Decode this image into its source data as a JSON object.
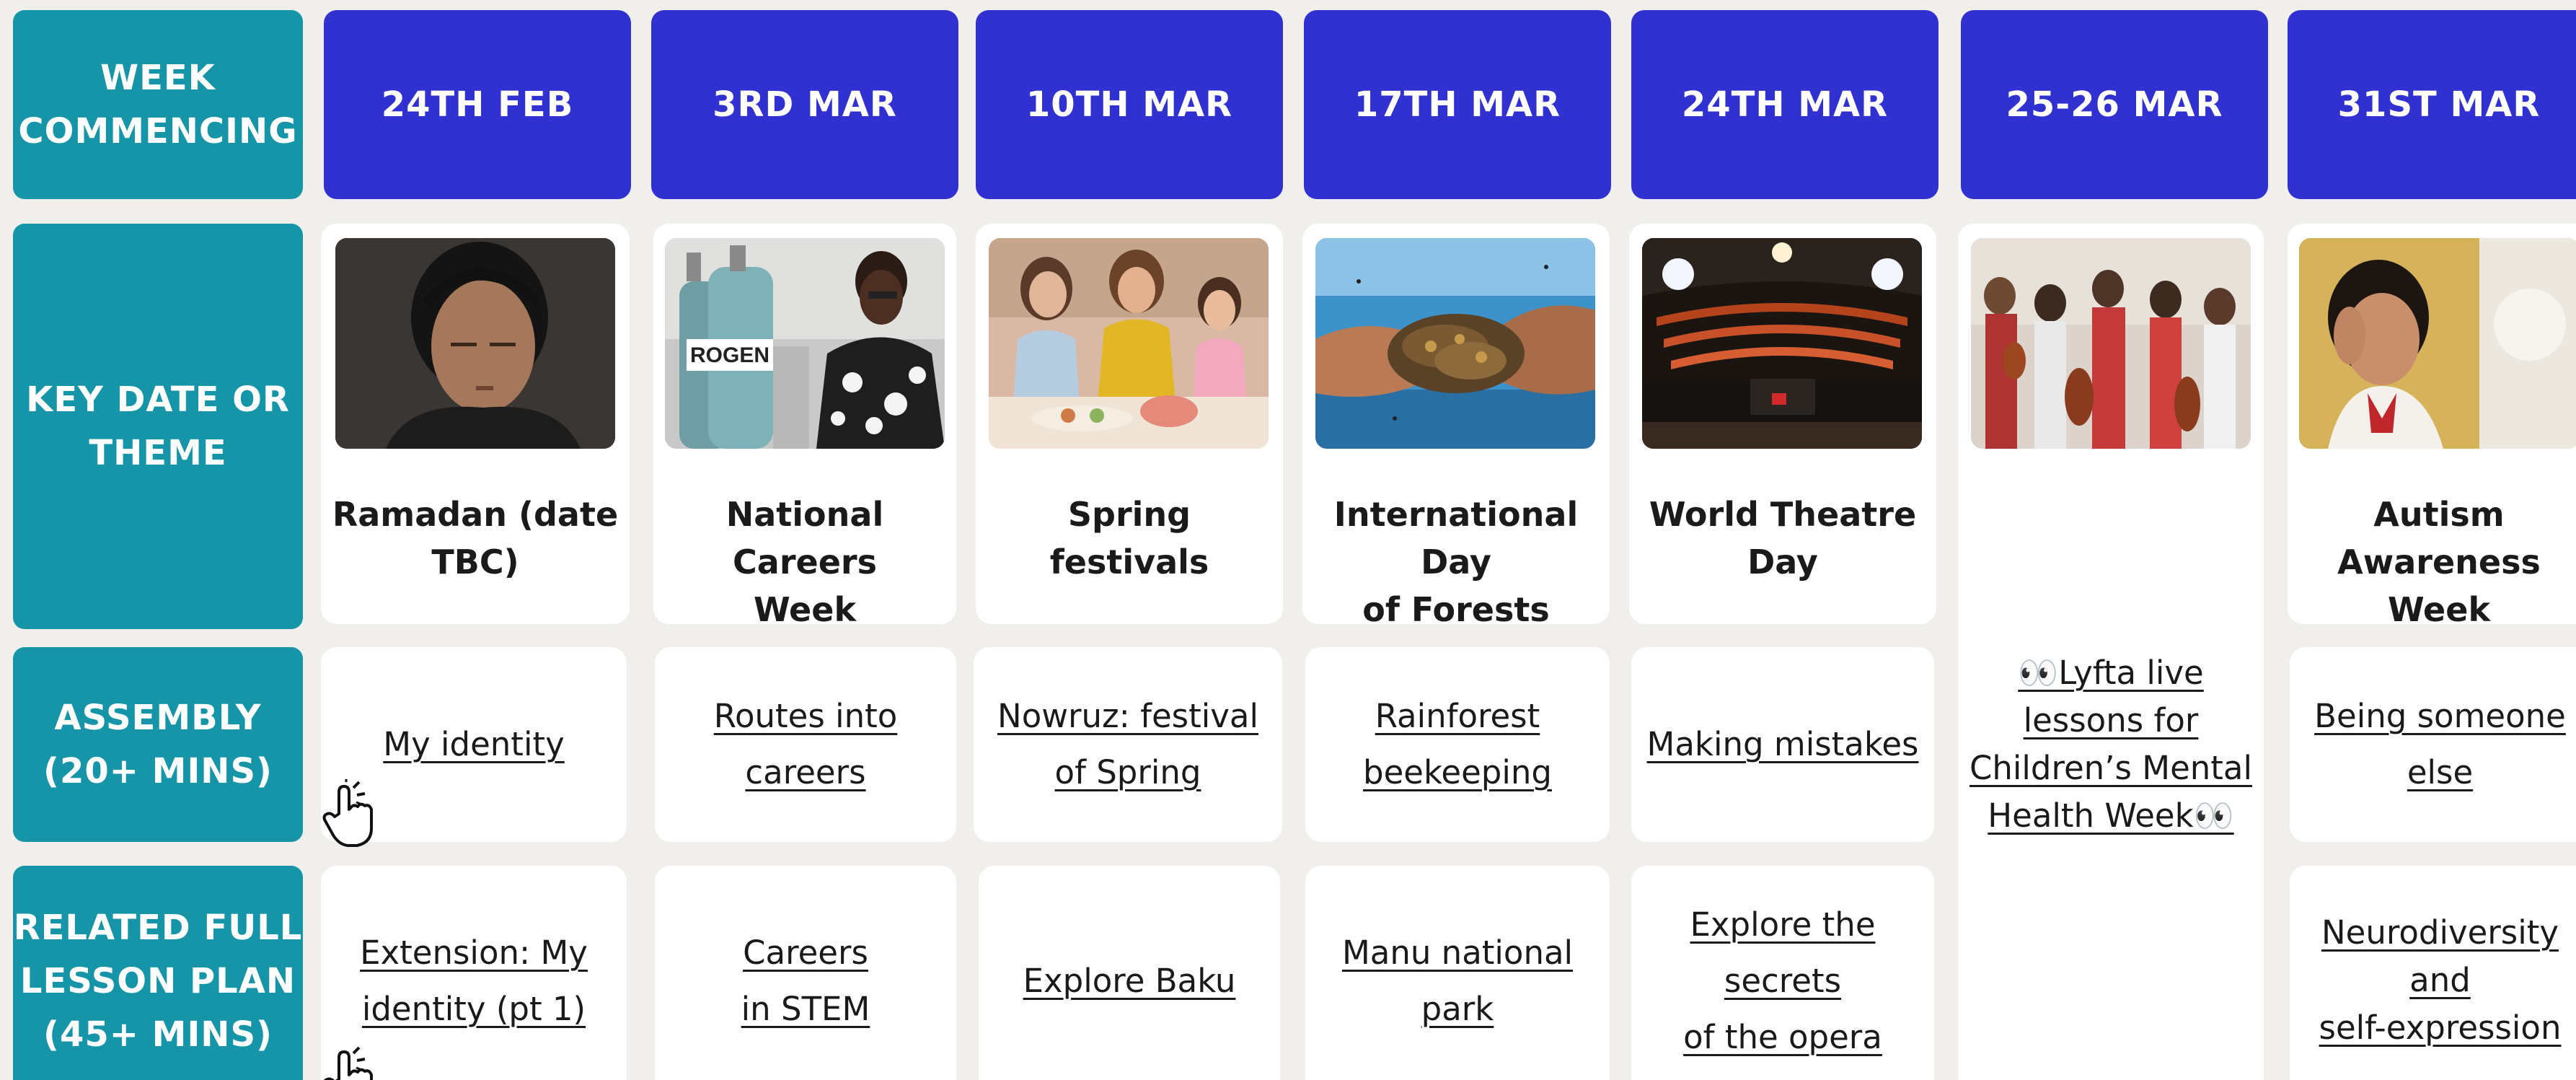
{
  "row_headers": {
    "week_commencing": "WEEK\nCOMMENCING",
    "key_date": "KEY DATE OR\nTHEME",
    "assembly": "ASSEMBLY\n(20+ MINS)",
    "lesson_plan": "RELATED FULL\nLESSON PLAN\n(45+ MINS)"
  },
  "weeks": [
    {
      "date": "24TH FEB",
      "theme": "Ramadan (date\nTBC)",
      "photo_icon": "boy-eyes-closed-photo",
      "assembly": "My identity",
      "lesson": "Extension: My\nidentity (pt 1)"
    },
    {
      "date": "3RD MAR",
      "theme": "National Careers\nWeek",
      "photo_icon": "scientist-gas-cylinders-photo",
      "photo_label": "ROGEN",
      "assembly": "Routes into\ncareers",
      "lesson": "Careers \nin STEM"
    },
    {
      "date": "10TH MAR",
      "theme": "Spring\nfestivals",
      "photo_icon": "girls-festival-table-photo",
      "assembly": "Nowruz: festival \nof Spring",
      "lesson": "Explore Baku"
    },
    {
      "date": "17TH MAR",
      "theme": "International Day\nof Forests",
      "photo_icon": "hands-honeycomb-photo",
      "assembly": "Rainforest\nbeekeeping",
      "lesson": "Manu national\npark"
    },
    {
      "date": "24TH MAR",
      "theme": "World Theatre\nDay",
      "photo_icon": "opera-house-stage-photo",
      "assembly": "Making mistakes",
      "lesson": "Explore the secrets\nof the opera"
    },
    {
      "date": "25-26 MAR",
      "theme": "",
      "photo_icon": "children-violins-photo",
      "assembly": "👀Lyfta live\nlessons for\nChildren’s Mental\nHealth Week👀",
      "lesson": ""
    },
    {
      "date": "31ST MAR",
      "theme": "Autism\nAwareness Week",
      "photo_icon": "child-covering-ear-photo",
      "assembly": "Being someone\nelse",
      "lesson": "Neurodiversity and\nself-expression"
    }
  ],
  "colors": {
    "background": "#f1efeb",
    "row_header": "#1795a8",
    "week_header": "#3131d1",
    "card": "#ffffff",
    "text": "#1a1a1a"
  },
  "cursor_icon": "hand-pointer-click-icon"
}
